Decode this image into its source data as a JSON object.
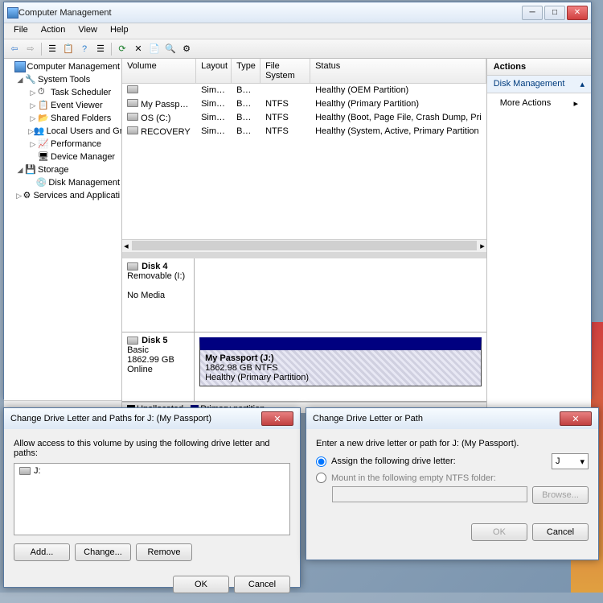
{
  "main_window": {
    "title": "Computer Management",
    "menus": [
      "File",
      "Action",
      "View",
      "Help"
    ]
  },
  "tree": {
    "root": "Computer Management",
    "system_tools": "System Tools",
    "task_scheduler": "Task Scheduler",
    "event_viewer": "Event Viewer",
    "shared_folders": "Shared Folders",
    "local_users": "Local Users and Gr",
    "performance": "Performance",
    "device_manager": "Device Manager",
    "storage": "Storage",
    "disk_management": "Disk Management",
    "services": "Services and Applicati"
  },
  "vol_headers": {
    "volume": "Volume",
    "layout": "Layout",
    "type": "Type",
    "fs": "File System",
    "status": "Status"
  },
  "volumes": [
    {
      "name": "",
      "layout": "Simple",
      "type": "Basic",
      "fs": "",
      "status": "Healthy (OEM Partition)"
    },
    {
      "name": "My Passport (J:)",
      "layout": "Simple",
      "type": "Basic",
      "fs": "NTFS",
      "status": "Healthy (Primary Partition)"
    },
    {
      "name": "OS (C:)",
      "layout": "Simple",
      "type": "Basic",
      "fs": "NTFS",
      "status": "Healthy (Boot, Page File, Crash Dump, Pri"
    },
    {
      "name": "RECOVERY",
      "layout": "Simple",
      "type": "Basic",
      "fs": "NTFS",
      "status": "Healthy (System, Active, Primary Partition"
    }
  ],
  "disks": {
    "d4": {
      "name": "Disk 4",
      "sub": "Removable (I:)",
      "status": "No Media"
    },
    "d5": {
      "name": "Disk 5",
      "sub": "Basic",
      "size": "1862.99 GB",
      "status": "Online",
      "vol_name": "My Passport  (J:)",
      "vol_size": "1862.98 GB NTFS",
      "vol_status": "Healthy (Primary Partition)"
    }
  },
  "legend": {
    "unallocated": "Unallocated",
    "primary": "Primary partition"
  },
  "actions": {
    "header": "Actions",
    "sub": "Disk Management",
    "more": "More Actions"
  },
  "dlg1": {
    "title": "Change Drive Letter and Paths for J: (My Passport)",
    "instruction": "Allow access to this volume by using the following drive letter and paths:",
    "item": "J:",
    "add": "Add...",
    "change": "Change...",
    "remove": "Remove",
    "ok": "OK",
    "cancel": "Cancel"
  },
  "dlg2": {
    "title": "Change Drive Letter or Path",
    "instruction": "Enter a new drive letter or path for J: (My Passport).",
    "opt_assign": "Assign the following drive letter:",
    "opt_mount": "Mount in the following empty NTFS folder:",
    "letter": "J",
    "browse": "Browse...",
    "ok": "OK",
    "cancel": "Cancel"
  }
}
